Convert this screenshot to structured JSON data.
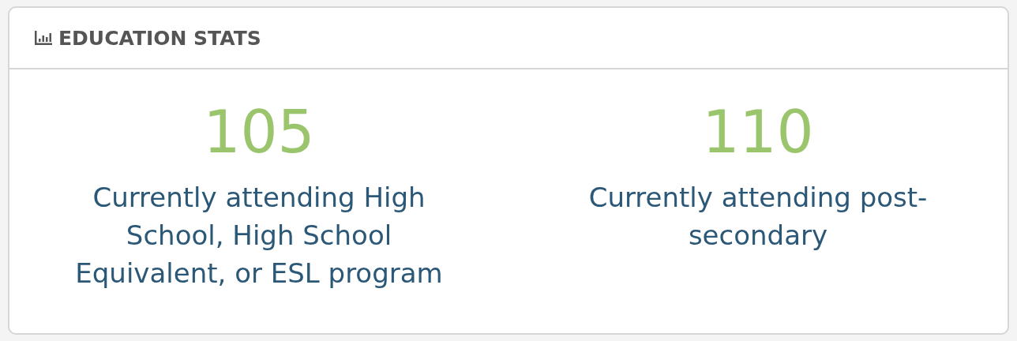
{
  "panel": {
    "title": "EDUCATION STATS"
  },
  "stats": [
    {
      "value": "105",
      "label": "Currently attending High School, High School Equivalent, or ESL program"
    },
    {
      "value": "110",
      "label": "Currently attending post-secondary"
    }
  ]
}
